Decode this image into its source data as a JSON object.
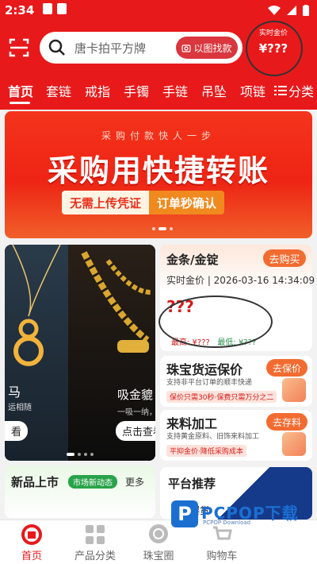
{
  "status_bar": {
    "time": "2:34"
  },
  "search": {
    "placeholder": "唐卡拍平方牌",
    "image_search_label": "以图找款"
  },
  "gold_widget": {
    "label": "实时金价",
    "price": "¥???"
  },
  "tabs": [
    {
      "label": "首页",
      "active": true
    },
    {
      "label": "套链"
    },
    {
      "label": "戒指"
    },
    {
      "label": "手镯"
    },
    {
      "label": "手链"
    },
    {
      "label": "吊坠"
    },
    {
      "label": "项链"
    }
  ],
  "category_button": {
    "label": "分类"
  },
  "banner": {
    "subtitle": "采购付款快人一步",
    "title": "采购用快捷转账",
    "pill_left": "无需上传凭证",
    "pill_right": "订单秒确认"
  },
  "carousel": {
    "left_title": "马",
    "left_sub": "运相随",
    "left_button": "看",
    "right_title": "吸金貔",
    "right_sub": "一吸一纳，",
    "right_button": "点击查看"
  },
  "gold_card": {
    "title": "金条/金锭",
    "button": "去购买",
    "live_label": "实时金价 | 2026-03-16 14:34:09",
    "price": "???",
    "high_label": "最高: ¥???",
    "low_label": "最低: ¥???"
  },
  "services": [
    {
      "title": "珠宝货运保价",
      "button": "去保价",
      "desc": "支持非平台订单的顺丰快递",
      "tag": "保价只需30秒·保费只需万分之二"
    },
    {
      "title": "来料加工",
      "button": "去存料",
      "desc": "支持黄金原料、旧饰来料加工",
      "tag": "平抑金价·降低采购成本"
    }
  ],
  "new_card": {
    "title": "新品上市",
    "badge": "市场新动态",
    "more": "更多"
  },
  "platform_card": {
    "title": "平台推荐",
    "sub": "热销爆货"
  },
  "bottom_nav": [
    {
      "label": "首页",
      "active": true
    },
    {
      "label": "产品分类"
    },
    {
      "label": "珠宝圈"
    },
    {
      "label": "购物车"
    }
  ],
  "watermark": {
    "brand": "PCPOP下载",
    "sub": "PCPOP Download"
  },
  "colors": {
    "brand_red": "#e8191b",
    "accent_orange": "#f26b30",
    "price_red": "#d61a1a"
  }
}
